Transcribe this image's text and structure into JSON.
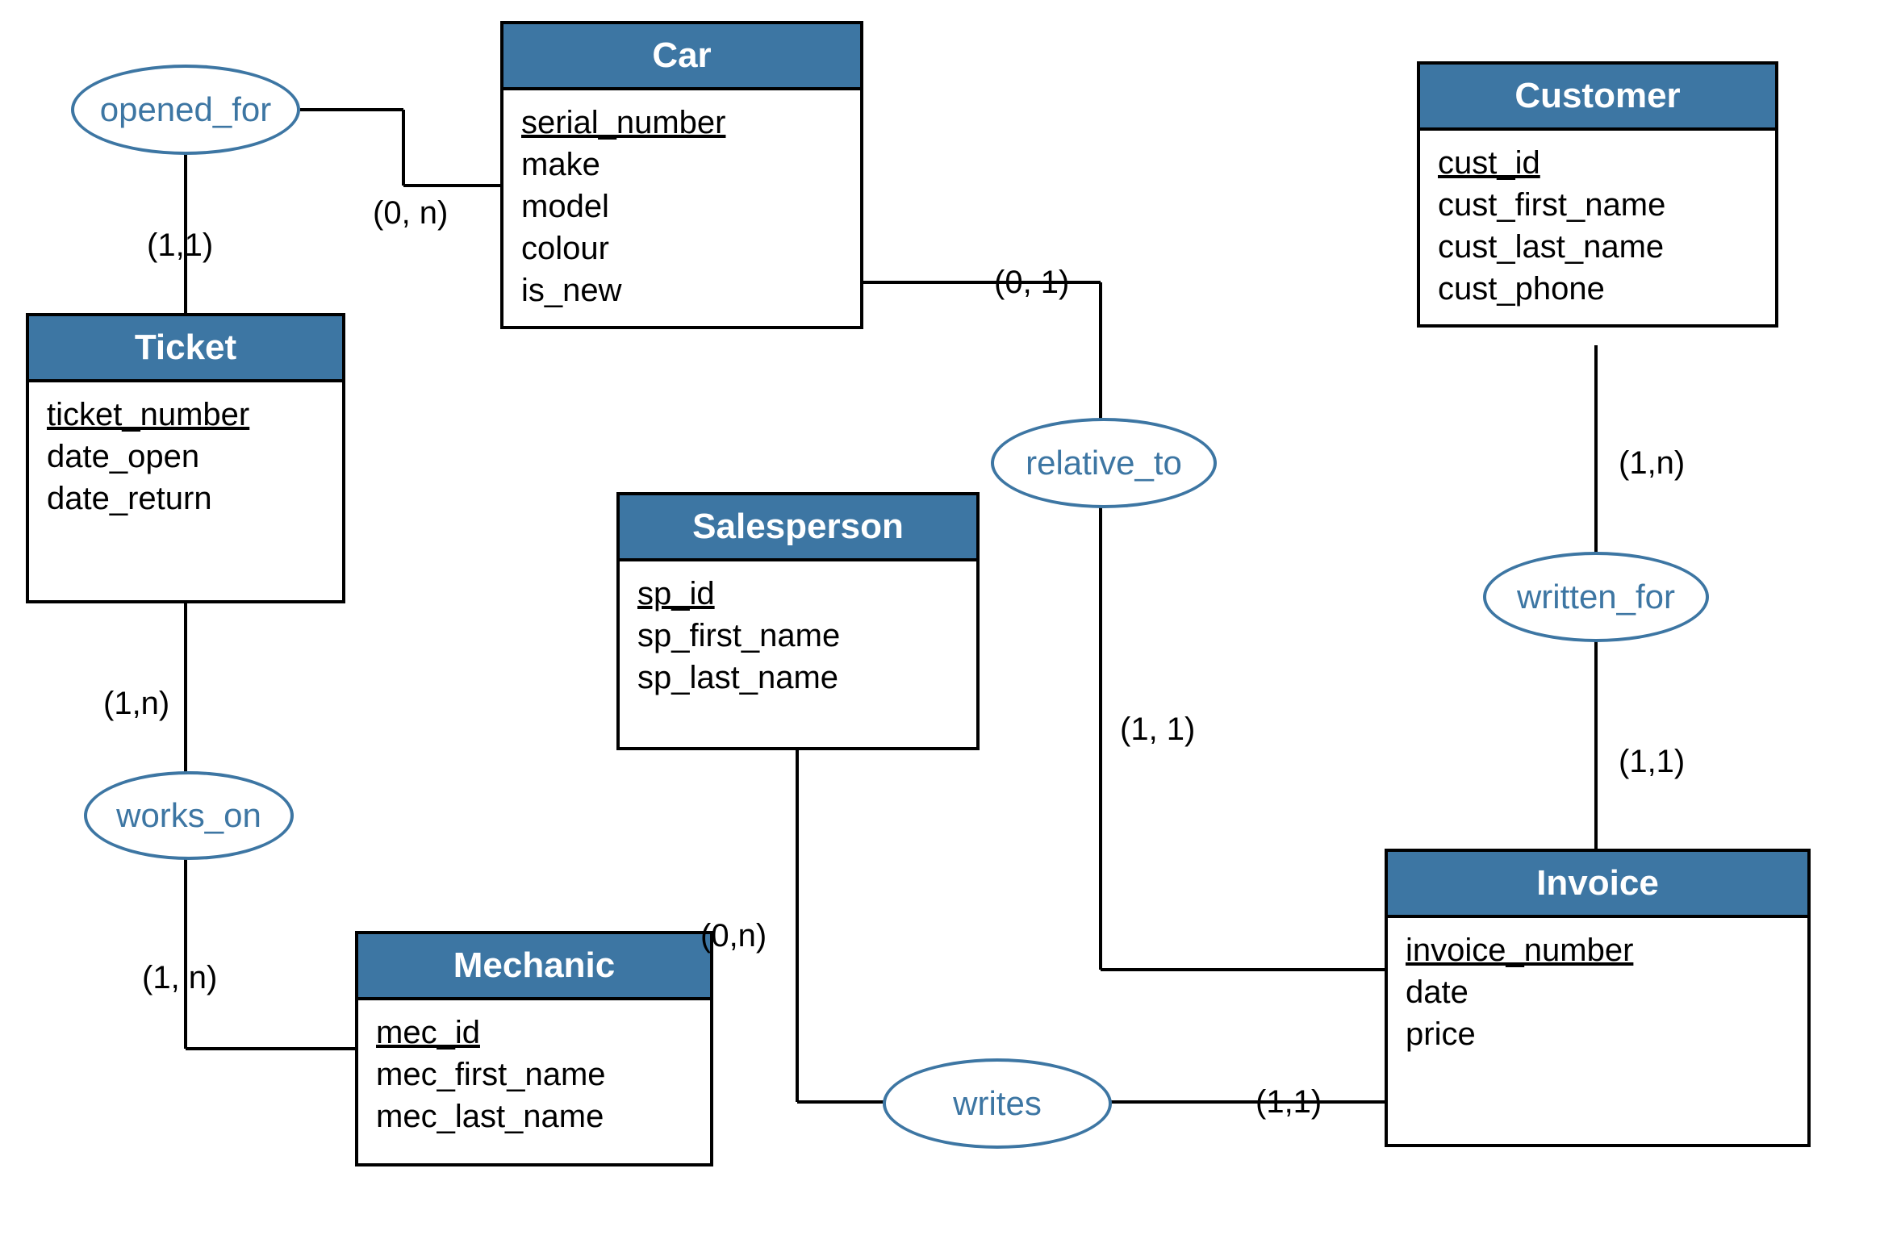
{
  "entities": {
    "car": {
      "title": "Car",
      "attrs": [
        "serial_number",
        "make",
        "model",
        "colour",
        "is_new"
      ],
      "pk": 0
    },
    "customer": {
      "title": "Customer",
      "attrs": [
        "cust_id",
        "cust_first_name",
        "cust_last_name",
        "cust_phone"
      ],
      "pk": 0
    },
    "ticket": {
      "title": "Ticket",
      "attrs": [
        "ticket_number",
        "date_open",
        "date_return"
      ],
      "pk": 0
    },
    "salesperson": {
      "title": "Salesperson",
      "attrs": [
        "sp_id",
        "sp_first_name",
        "sp_last_name"
      ],
      "pk": 0
    },
    "mechanic": {
      "title": "Mechanic",
      "attrs": [
        "mec_id",
        "mec_first_name",
        "mec_last_name"
      ],
      "pk": 0
    },
    "invoice": {
      "title": "Invoice",
      "attrs": [
        "invoice_number",
        "date",
        "price"
      ],
      "pk": 0
    }
  },
  "relationships": {
    "opened_for": "opened_for",
    "relative_to": "relative_to",
    "written_for": "written_for",
    "works_on": "works_on",
    "writes": "writes"
  },
  "cardinalities": {
    "opened_for_ticket": "(1,1)",
    "opened_for_car": "(0, n)",
    "relative_to_car": "(0, 1)",
    "relative_to_invoice": "(1, 1)",
    "written_for_customer": "(1,n)",
    "written_for_invoice": "(1,1)",
    "works_on_ticket": "(1,n)",
    "works_on_mechanic": "(1, n)",
    "writes_salesperson": "(0,n)",
    "writes_invoice": "(1,1)"
  }
}
